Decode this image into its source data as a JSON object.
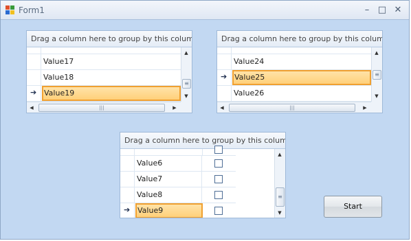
{
  "window": {
    "title": "Form1",
    "minimize_glyph": "–",
    "maximize_glyph": "□",
    "close_glyph": "✕"
  },
  "grid_left": {
    "group_panel_text": "Drag a column here to group by this column.",
    "rows": [
      "Value17",
      "Value18",
      "Value19"
    ],
    "selected_row": "Value19"
  },
  "grid_right": {
    "group_panel_text": "Drag a column here to group by this column.",
    "rows": [
      "Value24",
      "Value25",
      "Value26"
    ],
    "selected_row": "Value25"
  },
  "grid_bottom": {
    "group_panel_text": "Drag a column here to group by this column.",
    "rows": [
      {
        "value": "Value6",
        "checked": false
      },
      {
        "value": "Value7",
        "checked": false
      },
      {
        "value": "Value8",
        "checked": false
      },
      {
        "value": "Value9",
        "checked": false
      }
    ],
    "selected_row": "Value9"
  },
  "start_button": {
    "label": "Start"
  },
  "icons": {
    "row_indicator": "➔",
    "scroll_up": "▲",
    "scroll_down": "▼",
    "scroll_left": "◀",
    "scroll_right": "▶",
    "grip": "≡",
    "grip_h": "|||"
  },
  "colors": {
    "form_background": "#c2d8f2",
    "selection_fill": "#ffd07a",
    "selection_border": "#f0a030",
    "grid_border": "#9fb9d8"
  }
}
